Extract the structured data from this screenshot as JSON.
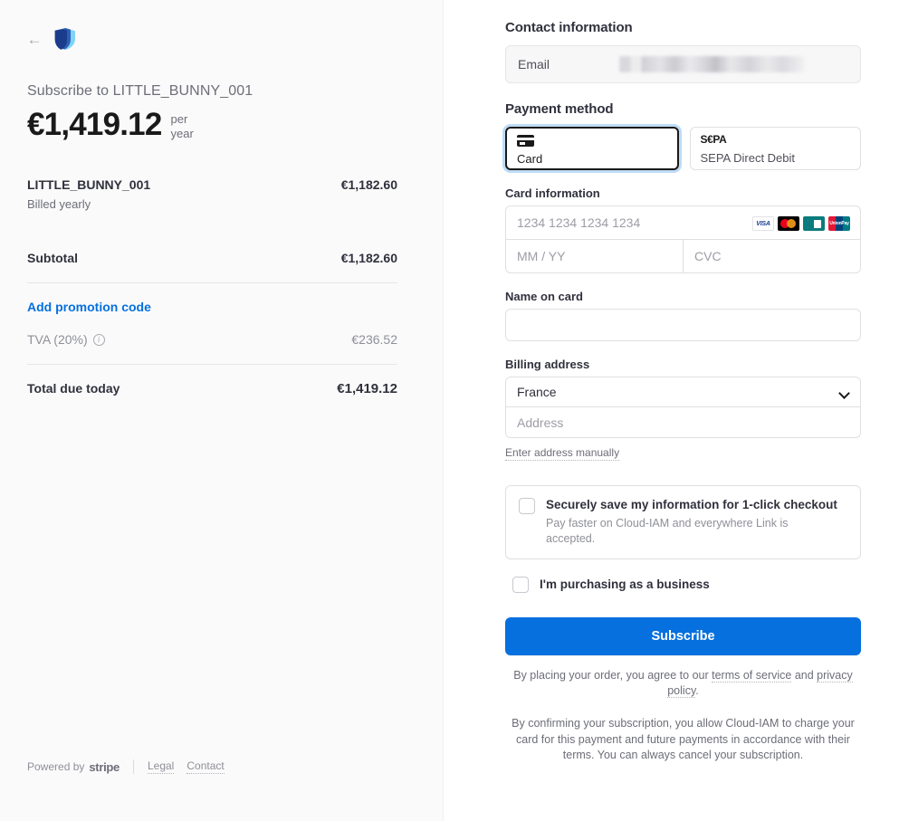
{
  "colors": {
    "accent_blue": "#0570DE",
    "left_panel_bg": "#FAFAFA",
    "right_panel_bg": "#FFFFFF",
    "text_primary": "#30313D",
    "text_muted": "#6D6E78",
    "border": "#E0E0E4",
    "focus_ring": "#BFDCF5"
  },
  "summary": {
    "back_icon": "arrow-left-icon",
    "logo_icon": "shield-logo-icon",
    "subscribe_to": "Subscribe to LITTLE_BUNNY_001",
    "price_amount": "€1,419.12",
    "price_period_line1": "per",
    "price_period_line2": "year",
    "line_items": [
      {
        "name": "LITTLE_BUNNY_001",
        "sublabel": "Billed yearly",
        "price": "€1,182.60"
      }
    ],
    "subtotal_label": "Subtotal",
    "subtotal_value": "€1,182.60",
    "promo_label": "Add promotion code",
    "tax_label": "TVA (20%)",
    "tax_info_icon": "info-circle-icon",
    "tax_value": "€236.52",
    "total_label": "Total due today",
    "total_value": "€1,419.12"
  },
  "footer": {
    "powered_by": "Powered by",
    "stripe_wordmark": "stripe",
    "links": [
      {
        "label": "Legal"
      },
      {
        "label": "Contact"
      }
    ]
  },
  "contact": {
    "section_title": "Contact information",
    "email_label": "Email",
    "email_value": ""
  },
  "payment_method": {
    "section_title": "Payment method",
    "tabs": [
      {
        "label": "Card",
        "icon": "credit-card-icon",
        "selected": true
      },
      {
        "label": "SEPA Direct Debit",
        "icon": "sepa-logo-icon",
        "logo_text": "S€PA",
        "selected": false
      }
    ]
  },
  "card": {
    "section_label": "Card information",
    "number_placeholder": "1234 1234 1234 1234",
    "number_value": "",
    "expiry_placeholder": "MM / YY",
    "expiry_value": "",
    "cvc_placeholder": "CVC",
    "cvc_value": "",
    "brands": [
      {
        "name": "visa-icon",
        "text": "VISA"
      },
      {
        "name": "mastercard-icon",
        "text": ""
      },
      {
        "name": "cb-cartes-bancaires-icon",
        "text": ""
      },
      {
        "name": "unionpay-icon",
        "text": "UnionPay"
      }
    ]
  },
  "name_on_card": {
    "label": "Name on card",
    "value": "",
    "placeholder": ""
  },
  "billing": {
    "label": "Billing address",
    "country_value": "France",
    "country_chevron_icon": "chevron-down-icon",
    "address_placeholder": "Address",
    "address_value": "",
    "manual_link": "Enter address manually"
  },
  "link_save": {
    "checked": false,
    "title": "Securely save my information for 1-click checkout",
    "subtitle": "Pay faster on Cloud-IAM and everywhere Link is accepted."
  },
  "business": {
    "checked": false,
    "label": "I'm purchasing as a business"
  },
  "submit": {
    "label": "Subscribe"
  },
  "legal": {
    "prefix": "By placing your order, you agree to our ",
    "terms_link": "terms of service",
    "middle": " and ",
    "privacy_link": "privacy policy",
    "suffix": "."
  },
  "confirmation_note": {
    "text": "By confirming your subscription, you allow Cloud-IAM to charge your card for this payment and future payments in accordance with their terms. You can always cancel your subscription."
  }
}
